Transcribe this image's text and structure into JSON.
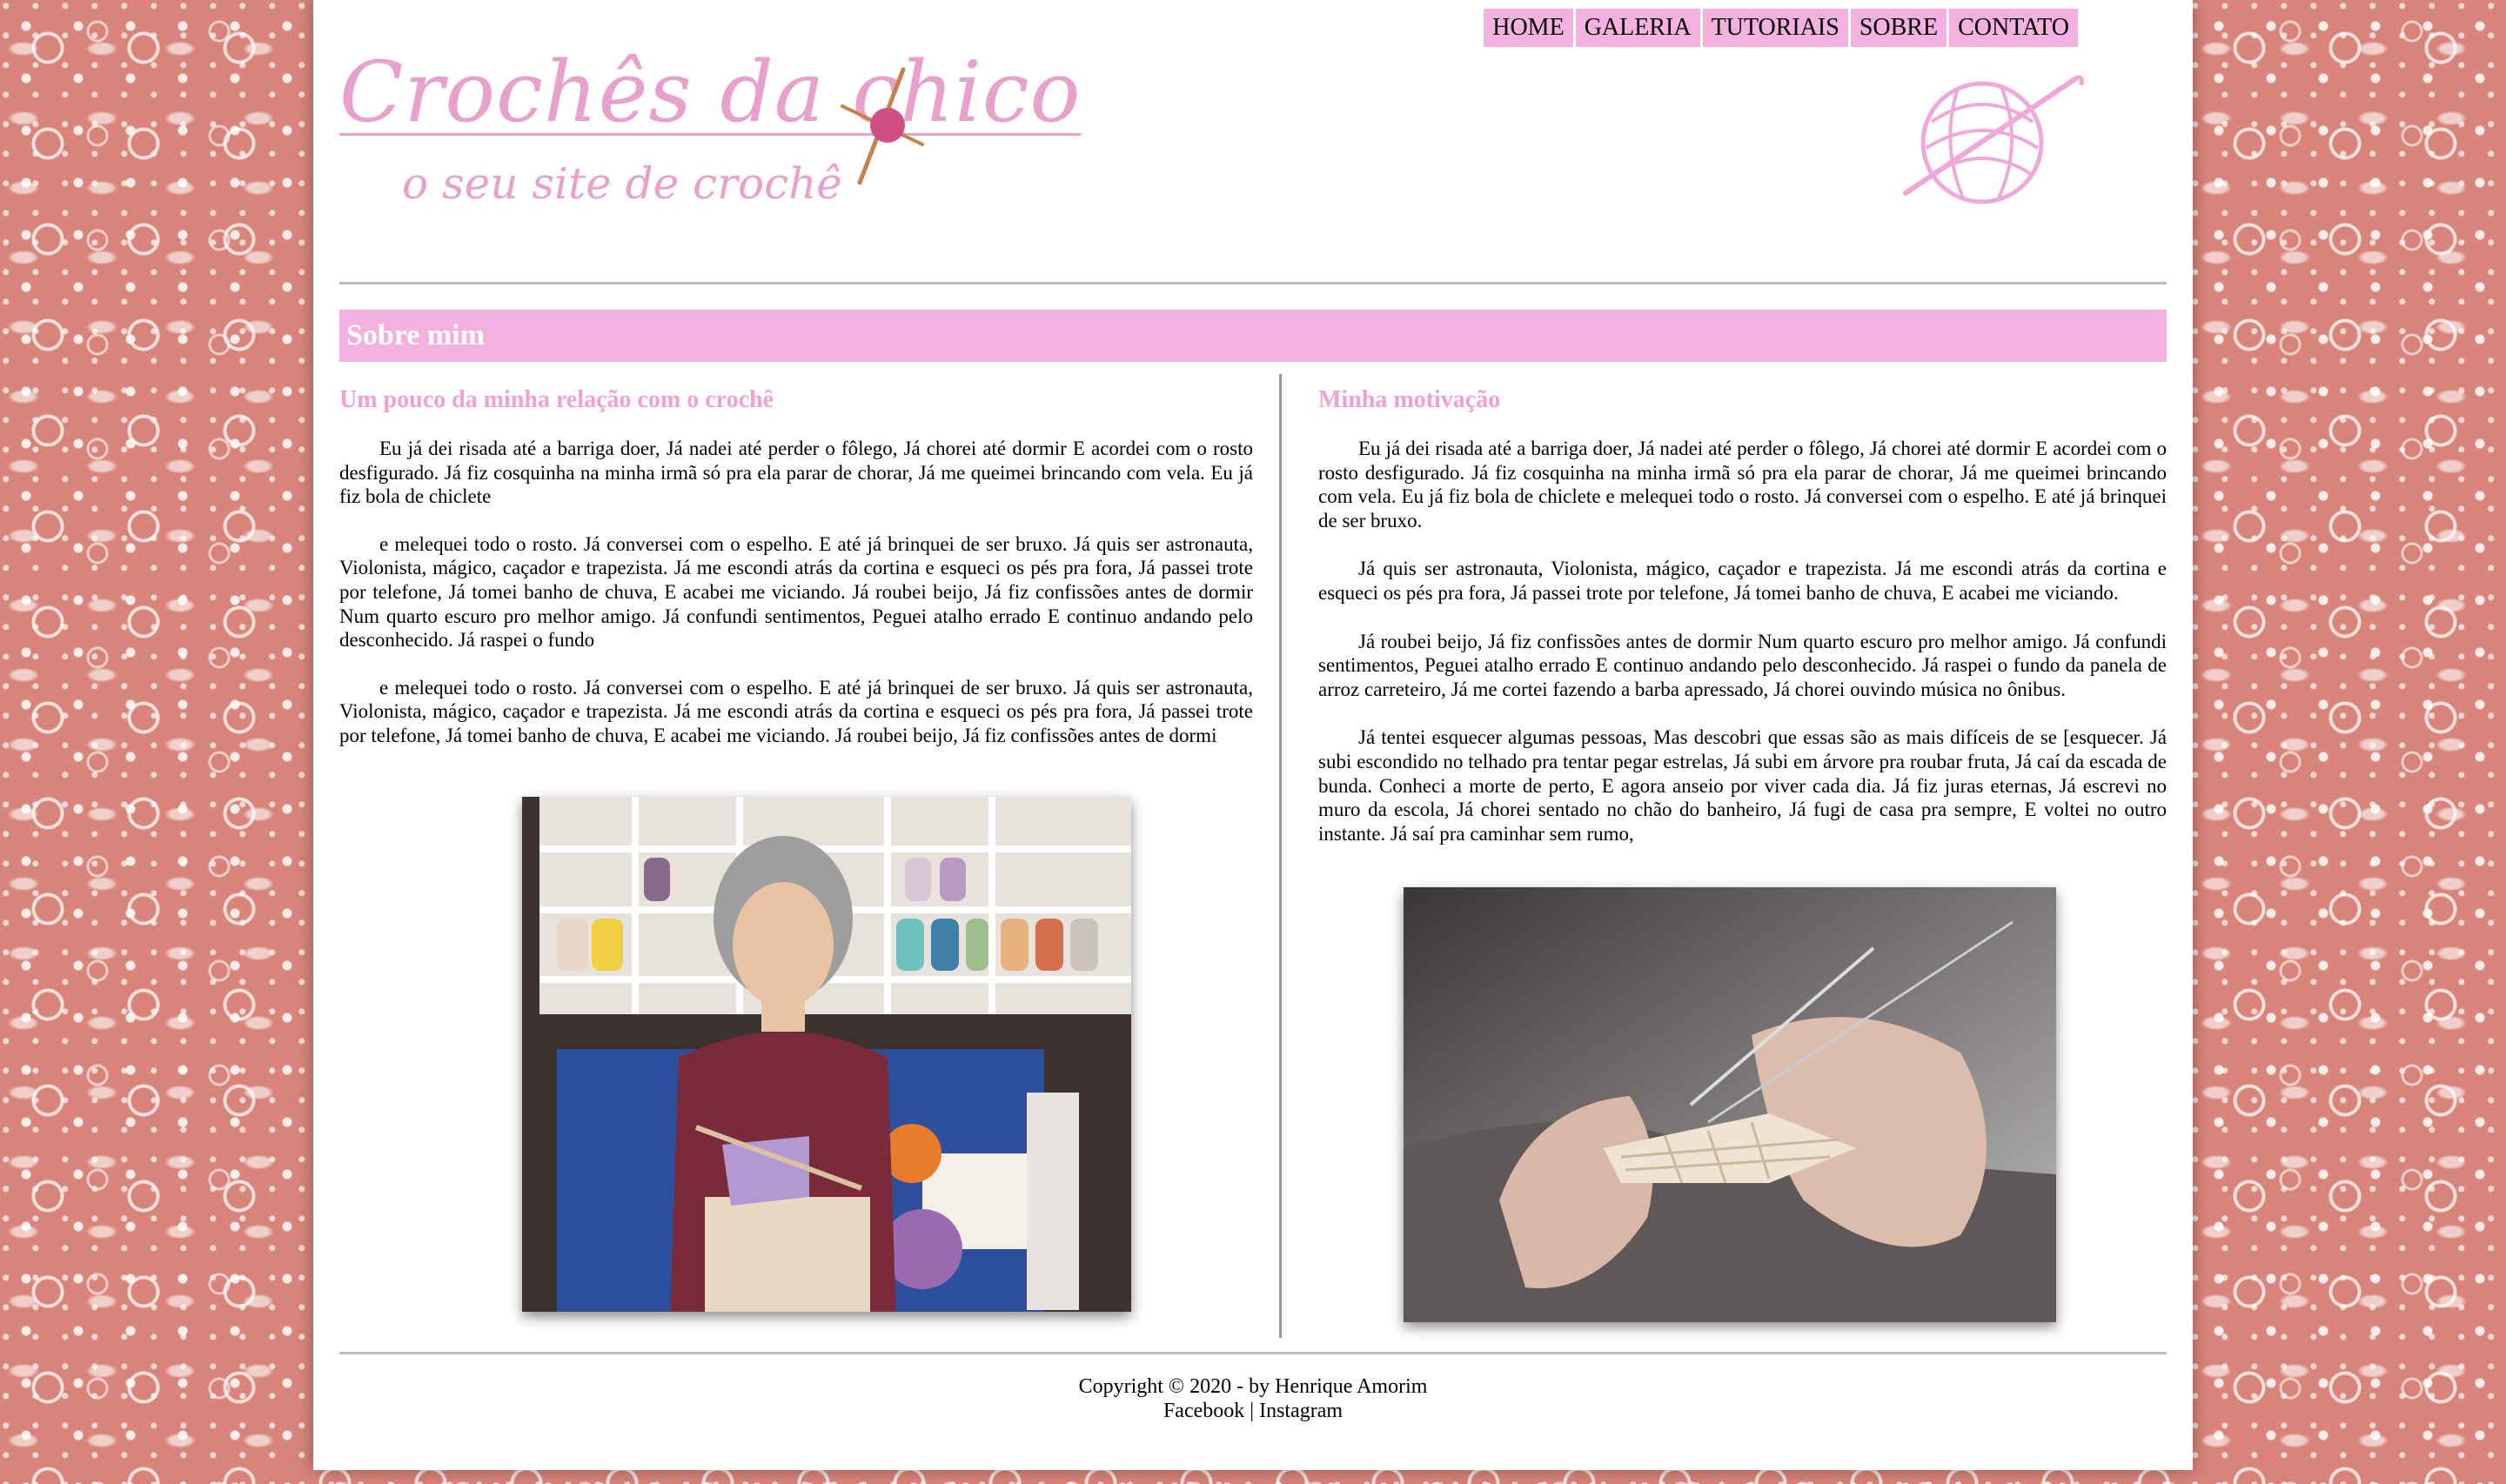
{
  "nav": {
    "items": [
      {
        "label": "HOME"
      },
      {
        "label": "GALERIA"
      },
      {
        "label": "TUTORIAIS"
      },
      {
        "label": "SOBRE"
      },
      {
        "label": "CONTATO"
      }
    ]
  },
  "logo": {
    "title": "Crochês da chico",
    "subtitle": "o seu site de crochê"
  },
  "section": {
    "title": "Sobre mim"
  },
  "left": {
    "heading": "Um pouco da minha relação com o crochê",
    "paragraphs": [
      "Eu já dei risada até a barriga doer, Já nadei até perder o fôlego, Já chorei até dormir E acordei com o rosto desfigurado. Já fiz cosquinha na minha irmã só pra ela parar de chorar, Já me queimei brincando com vela. Eu já fiz bola de chiclete",
      "e melequei todo o rosto. Já conversei com o espelho. E até já brinquei de ser bruxo. Já quis ser astronauta, Violonista, mágico, caçador e trapezista. Já me escondi atrás da cortina e esqueci os pés pra fora, Já passei trote por telefone, Já tomei banho de chuva, E acabei me viciando. Já roubei beijo, Já fiz confissões antes de dormir Num quarto escuro pro melhor amigo. Já confundi sentimentos, Peguei atalho errado E continuo andando pelo desconhecido. Já raspei o fundo",
      "e melequei todo o rosto. Já conversei com o espelho. E até já brinquei de ser bruxo. Já quis ser astronauta, Violonista, mágico, caçador e trapezista. Já me escondi atrás da cortina e esqueci os pés pra fora, Já passei trote por telefone, Já tomei banho de chuva, E acabei me viciando. Já roubei beijo, Já fiz confissões antes de dormi"
    ]
  },
  "right": {
    "heading": "Minha motivação",
    "paragraphs": [
      "Eu já dei risada até a barriga doer, Já nadei até perder o fôlego, Já chorei até dormir E acordei com o rosto desfigurado. Já fiz cosquinha na minha irmã só pra ela parar de chorar, Já me queimei brincando com vela. Eu já fiz bola de chiclete e melequei todo o rosto. Já conversei com o espelho. E até já brinquei de ser bruxo.",
      "Já quis ser astronauta, Violonista, mágico, caçador e trapezista. Já me escondi atrás da cortina e esqueci os pés pra fora, Já passei trote por telefone, Já tomei banho de chuva, E acabei me viciando.",
      "Já roubei beijo, Já fiz confissões antes de dormir Num quarto escuro pro melhor amigo. Já confundi sentimentos, Peguei atalho errado E continuo andando pelo desconhecido. Já raspei o fundo da panela de arroz carreteiro, Já me cortei fazendo a barba apressado, Já chorei ouvindo música no ônibus.",
      "Já tentei esquecer algumas pessoas, Mas descobri que essas são as mais difíceis de se [esquecer. Já subi escondido no telhado pra tentar pegar estrelas, Já subi em árvore pra roubar fruta, Já caí da escada de bunda. Conheci a morte de perto, E agora anseio por viver cada dia. Já fiz juras eternas, Já escrevi no muro da escola, Já chorei sentado no chão do banheiro, Já fugi de casa pra sempre, E voltei no outro instante. Já saí pra caminhar sem rumo,"
    ]
  },
  "footer": {
    "copyright": "Copyright © 2020 - by Henrique Amorim",
    "facebook": "Facebook",
    "separator": "|",
    "instagram": "Instagram"
  },
  "colors": {
    "accent_pink": "#f4b0de",
    "heading_pink": "#f0a0d4",
    "background_lace": "#d9847a"
  },
  "icons": [
    "crochet-hook-icon",
    "yarn-ball-icon"
  ]
}
